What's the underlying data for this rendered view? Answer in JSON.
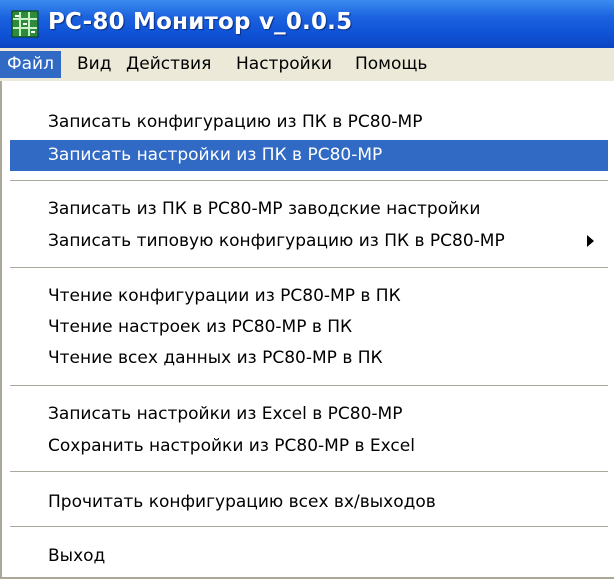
{
  "window": {
    "title": "PC-80 Монитор v_0.0.5",
    "icon": "grid-app-icon"
  },
  "menubar": {
    "items": [
      "Файл",
      "Вид",
      "Действия",
      "Настройки",
      "Помощь"
    ],
    "active_index": 0
  },
  "file_menu": {
    "items": [
      "Записать конфигурацию из ПК в PC80-MP",
      "Записать настройки из ПК в PC80-MP",
      "Записать из ПК в PC80-MP заводские настройки",
      "Записать типовую конфигурацию из ПК в PC80-MP",
      "Чтение конфигурации из PC80-MP в ПК",
      "Чтение настроек из PC80-MP в ПК",
      "Чтение всех данных из PC80-MP в ПК",
      "Записать настройки из Excel в PC80-MP",
      "Сохранить настройки из PC80-MP в Excel",
      "Прочитать конфигурацию всех вх/выходов",
      "Выход"
    ],
    "highlighted_index": 1,
    "submenu_index": 3
  },
  "colors": {
    "title_bar": "#0f52d6",
    "menu_bar": "#ece9d8",
    "highlight": "#316ac5",
    "separator": "#aca899"
  }
}
